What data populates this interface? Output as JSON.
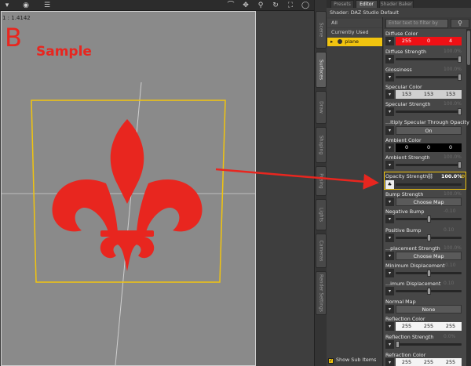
{
  "viewport": {
    "scale_label": "1 : 1.4142",
    "overlay_letter": "B",
    "overlay_text": "Sample",
    "overlay_color": "#e8261f"
  },
  "toolbar_icons": [
    "dropdown-icon",
    "circle-icon",
    "menu-icon"
  ],
  "toolbar_right_icons": [
    "orbit-icon",
    "pan-icon",
    "zoom-icon",
    "rotate-icon",
    "frame-icon",
    "light-icon"
  ],
  "top_tabs": [
    {
      "label": "Presets",
      "active": false
    },
    {
      "label": "Editor",
      "active": true
    },
    {
      "label": "Shader Baker",
      "active": false
    }
  ],
  "vertical_tabs": [
    {
      "label": "Scene",
      "active": false
    },
    {
      "label": "Surfaces",
      "active": true
    },
    {
      "label": "Draw",
      "active": false
    },
    {
      "label": "Shaping",
      "active": false
    },
    {
      "label": "Posing",
      "active": false
    },
    {
      "label": "Lights",
      "active": false
    },
    {
      "label": "Cameras",
      "active": false
    },
    {
      "label": "Render Settings",
      "active": false
    }
  ],
  "shader_title": "Shader: DAZ Studio Default",
  "list": {
    "all": "All",
    "currently_used": "Currently Used",
    "selected": "plane",
    "show_sub_items": "Show Sub Items"
  },
  "filter": {
    "placeholder": "Enter text to filter by"
  },
  "properties": {
    "diffuse_color": {
      "title": "Diffuse Color",
      "r": "255",
      "g": "0",
      "b": "4",
      "color": "#ef1015"
    },
    "diffuse_strength": {
      "title": "Diffuse Strength",
      "value": "100.0%",
      "level": 1.0
    },
    "glossiness": {
      "title": "Glossiness",
      "value": "100.0%",
      "level": 1.0
    },
    "specular_color": {
      "title": "Specular Color",
      "r": "153",
      "g": "153",
      "b": "153"
    },
    "specular_strength": {
      "title": "Specular Strength",
      "value": "100.0%",
      "level": 1.0
    },
    "multiply_specular": {
      "title": "...ltiply Specular Through Opacity",
      "button": "On"
    },
    "ambient_color": {
      "title": "Ambient Color",
      "r": "0",
      "g": "0",
      "b": "0"
    },
    "ambient_strength": {
      "title": "Ambient Strength",
      "value": "100.0%",
      "level": 1.0
    },
    "opacity_strength": {
      "title": "Opacity Strength",
      "value": "100.0%"
    },
    "bump_strength": {
      "title": "Bump Strength",
      "value": "100.0%",
      "button": "Choose Map"
    },
    "negative_bump": {
      "title": "Negative Bump",
      "value": "-0.10",
      "level": 0.5
    },
    "positive_bump": {
      "title": "Positive Bump",
      "value": "0.10",
      "level": 0.5
    },
    "displacement_strength": {
      "title": "...placement Strength",
      "value": "100.0%",
      "button": "Choose Map"
    },
    "minimum_displacement": {
      "title": "Minimum Displacement",
      "value": "-0.10",
      "level": 0.5
    },
    "maximum_displacement": {
      "title": "...imum Displacement",
      "value": "0.10",
      "level": 0.5
    },
    "normal_map": {
      "title": "Normal Map",
      "button": "None"
    },
    "reflection_color": {
      "title": "Reflection Color",
      "r": "255",
      "g": "255",
      "b": "255"
    },
    "reflection_strength": {
      "title": "Reflection Strength",
      "value": "0.0%",
      "level": 0.0
    },
    "refraction_color": {
      "title": "Refraction Color",
      "r": "255",
      "g": "255",
      "b": "255"
    }
  }
}
